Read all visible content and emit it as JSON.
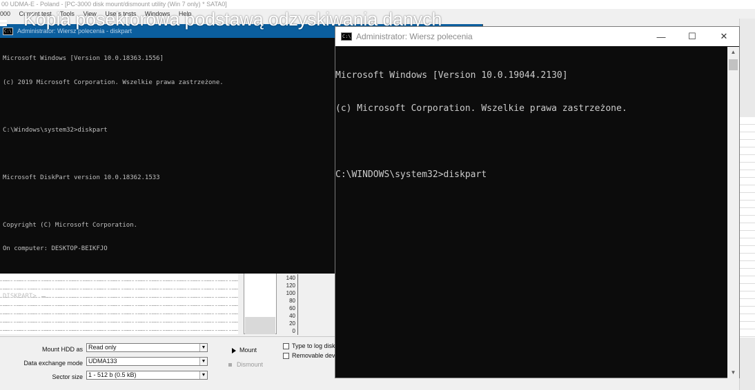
{
  "background_app": {
    "title": "00 UDMA-E - Poland - [PC-3000 disk mount/dismount utility (Win 7 only) * SATA0]",
    "menu": [
      "000",
      "Current test",
      "Tools",
      "View",
      "Users tests",
      "Windows",
      "Help"
    ],
    "scale_ticks": [
      "140",
      "120",
      "100",
      "80",
      "60",
      "40",
      "20",
      "0"
    ],
    "fields": {
      "mount_as_label": "Mount HDD as",
      "mount_as_value": "Read only",
      "exchange_label": "Data exchange mode",
      "exchange_value": "UDMA133",
      "sector_label": "Sector size",
      "sector_value": "1 - 512 b (0.5 kB)"
    },
    "mount_label": "Mount",
    "dismount_label": "Dismount",
    "checkbox_log": "Type to log disk a",
    "checkbox_removable": "Removable devic"
  },
  "overlay": {
    "heading": "Kopia posektorowa podstawą odzyskiwania danych"
  },
  "console_left": {
    "title": "Administrator: Wiersz polecenia - diskpart",
    "lines": [
      "Microsoft Windows [Version 10.0.18363.1556]",
      "(c) 2019 Microsoft Corporation. Wszelkie prawa zastrzeżone.",
      "",
      "C:\\Windows\\system32>diskpart",
      "",
      "Microsoft DiskPart version 10.0.18362.1533",
      "",
      "Copyright (C) Microsoft Corporation.",
      "On computer: DESKTOP-BEIKFJO",
      "",
      "DISKPART> "
    ]
  },
  "console_right": {
    "title": "Administrator: Wiersz polecenia",
    "icon_text": "C:\\",
    "minimize": "—",
    "maximize": "☐",
    "close": "✕",
    "lines": [
      "Microsoft Windows [Version 10.0.19044.2130]",
      "(c) Microsoft Corporation. Wszelkie prawa zastrzeżone.",
      "",
      "C:\\WINDOWS\\system32>diskpart"
    ]
  }
}
